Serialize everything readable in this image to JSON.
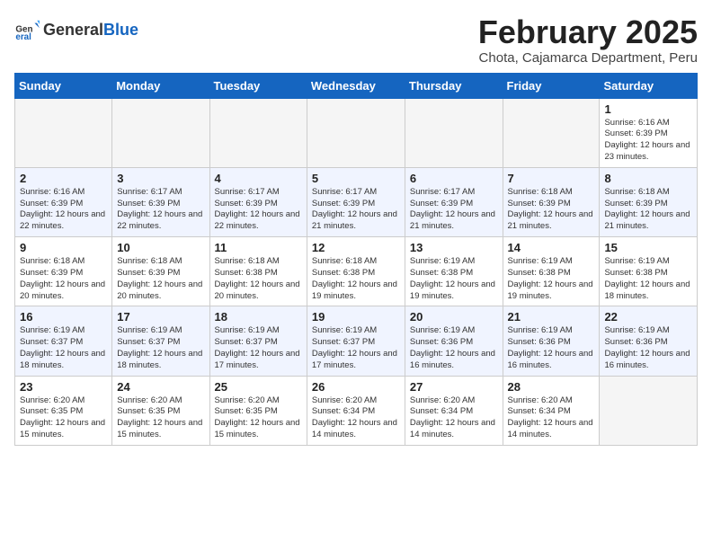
{
  "header": {
    "logo_general": "General",
    "logo_blue": "Blue",
    "month_title": "February 2025",
    "subtitle": "Chota, Cajamarca Department, Peru"
  },
  "days_of_week": [
    "Sunday",
    "Monday",
    "Tuesday",
    "Wednesday",
    "Thursday",
    "Friday",
    "Saturday"
  ],
  "weeks": [
    {
      "days": [
        {
          "num": "",
          "info": ""
        },
        {
          "num": "",
          "info": ""
        },
        {
          "num": "",
          "info": ""
        },
        {
          "num": "",
          "info": ""
        },
        {
          "num": "",
          "info": ""
        },
        {
          "num": "",
          "info": ""
        },
        {
          "num": "1",
          "info": "Sunrise: 6:16 AM\nSunset: 6:39 PM\nDaylight: 12 hours and 23 minutes."
        }
      ]
    },
    {
      "days": [
        {
          "num": "2",
          "info": "Sunrise: 6:16 AM\nSunset: 6:39 PM\nDaylight: 12 hours and 22 minutes."
        },
        {
          "num": "3",
          "info": "Sunrise: 6:17 AM\nSunset: 6:39 PM\nDaylight: 12 hours and 22 minutes."
        },
        {
          "num": "4",
          "info": "Sunrise: 6:17 AM\nSunset: 6:39 PM\nDaylight: 12 hours and 22 minutes."
        },
        {
          "num": "5",
          "info": "Sunrise: 6:17 AM\nSunset: 6:39 PM\nDaylight: 12 hours and 21 minutes."
        },
        {
          "num": "6",
          "info": "Sunrise: 6:17 AM\nSunset: 6:39 PM\nDaylight: 12 hours and 21 minutes."
        },
        {
          "num": "7",
          "info": "Sunrise: 6:18 AM\nSunset: 6:39 PM\nDaylight: 12 hours and 21 minutes."
        },
        {
          "num": "8",
          "info": "Sunrise: 6:18 AM\nSunset: 6:39 PM\nDaylight: 12 hours and 21 minutes."
        }
      ]
    },
    {
      "days": [
        {
          "num": "9",
          "info": "Sunrise: 6:18 AM\nSunset: 6:39 PM\nDaylight: 12 hours and 20 minutes."
        },
        {
          "num": "10",
          "info": "Sunrise: 6:18 AM\nSunset: 6:39 PM\nDaylight: 12 hours and 20 minutes."
        },
        {
          "num": "11",
          "info": "Sunrise: 6:18 AM\nSunset: 6:38 PM\nDaylight: 12 hours and 20 minutes."
        },
        {
          "num": "12",
          "info": "Sunrise: 6:18 AM\nSunset: 6:38 PM\nDaylight: 12 hours and 19 minutes."
        },
        {
          "num": "13",
          "info": "Sunrise: 6:19 AM\nSunset: 6:38 PM\nDaylight: 12 hours and 19 minutes."
        },
        {
          "num": "14",
          "info": "Sunrise: 6:19 AM\nSunset: 6:38 PM\nDaylight: 12 hours and 19 minutes."
        },
        {
          "num": "15",
          "info": "Sunrise: 6:19 AM\nSunset: 6:38 PM\nDaylight: 12 hours and 18 minutes."
        }
      ]
    },
    {
      "days": [
        {
          "num": "16",
          "info": "Sunrise: 6:19 AM\nSunset: 6:37 PM\nDaylight: 12 hours and 18 minutes."
        },
        {
          "num": "17",
          "info": "Sunrise: 6:19 AM\nSunset: 6:37 PM\nDaylight: 12 hours and 18 minutes."
        },
        {
          "num": "18",
          "info": "Sunrise: 6:19 AM\nSunset: 6:37 PM\nDaylight: 12 hours and 17 minutes."
        },
        {
          "num": "19",
          "info": "Sunrise: 6:19 AM\nSunset: 6:37 PM\nDaylight: 12 hours and 17 minutes."
        },
        {
          "num": "20",
          "info": "Sunrise: 6:19 AM\nSunset: 6:36 PM\nDaylight: 12 hours and 16 minutes."
        },
        {
          "num": "21",
          "info": "Sunrise: 6:19 AM\nSunset: 6:36 PM\nDaylight: 12 hours and 16 minutes."
        },
        {
          "num": "22",
          "info": "Sunrise: 6:19 AM\nSunset: 6:36 PM\nDaylight: 12 hours and 16 minutes."
        }
      ]
    },
    {
      "days": [
        {
          "num": "23",
          "info": "Sunrise: 6:20 AM\nSunset: 6:35 PM\nDaylight: 12 hours and 15 minutes."
        },
        {
          "num": "24",
          "info": "Sunrise: 6:20 AM\nSunset: 6:35 PM\nDaylight: 12 hours and 15 minutes."
        },
        {
          "num": "25",
          "info": "Sunrise: 6:20 AM\nSunset: 6:35 PM\nDaylight: 12 hours and 15 minutes."
        },
        {
          "num": "26",
          "info": "Sunrise: 6:20 AM\nSunset: 6:34 PM\nDaylight: 12 hours and 14 minutes."
        },
        {
          "num": "27",
          "info": "Sunrise: 6:20 AM\nSunset: 6:34 PM\nDaylight: 12 hours and 14 minutes."
        },
        {
          "num": "28",
          "info": "Sunrise: 6:20 AM\nSunset: 6:34 PM\nDaylight: 12 hours and 14 minutes."
        },
        {
          "num": "",
          "info": ""
        }
      ]
    }
  ]
}
